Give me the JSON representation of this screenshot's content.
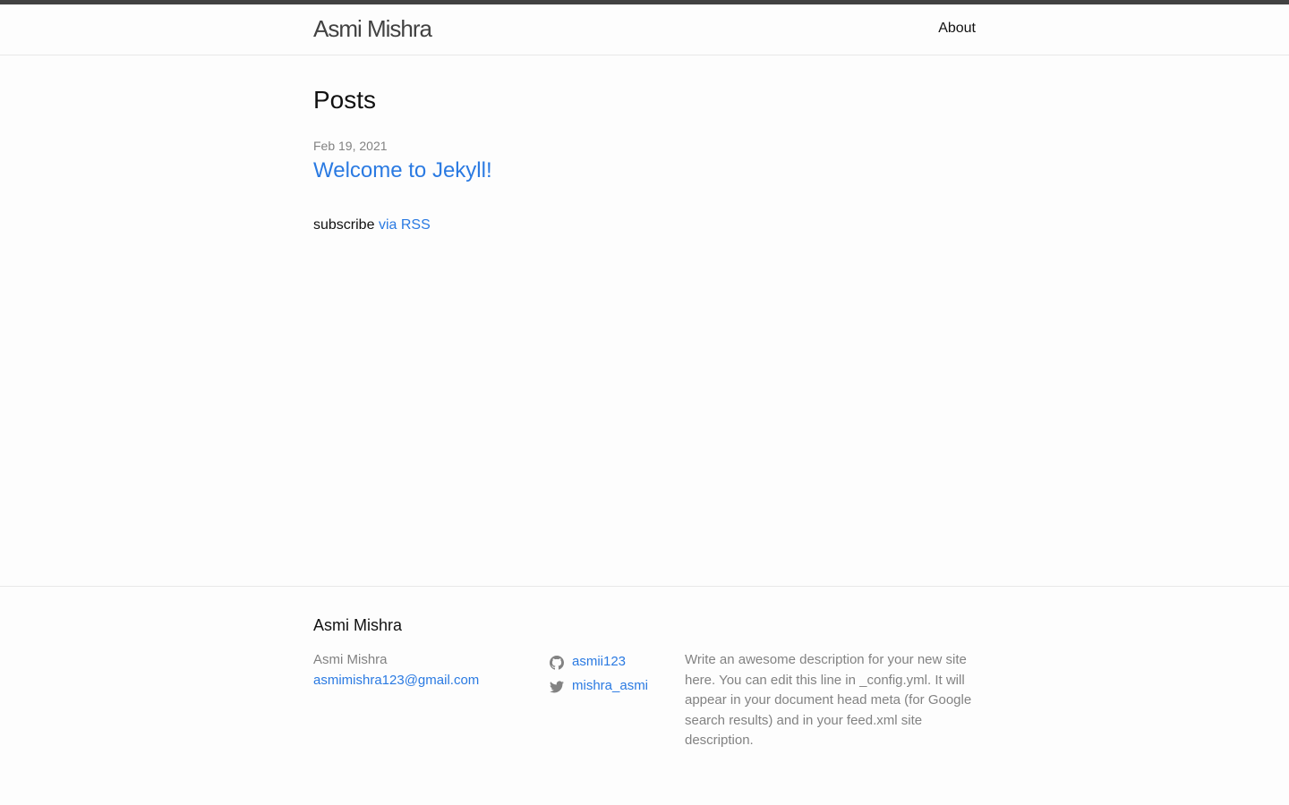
{
  "header": {
    "site_title": "Asmi Mishra",
    "nav_about": "About"
  },
  "main": {
    "heading": "Posts",
    "posts": [
      {
        "date": "Feb 19, 2021",
        "title": "Welcome to Jekyll!"
      }
    ],
    "rss_prefix": "subscribe",
    "rss_link": "via RSS"
  },
  "footer": {
    "heading": "Asmi Mishra",
    "name": "Asmi Mishra",
    "email": "asmimishra123@gmail.com",
    "social": [
      {
        "icon": "github-icon",
        "label": "asmii123"
      },
      {
        "icon": "twitter-icon",
        "label": "mishra_asmi"
      }
    ],
    "description": "Write an awesome description for your new site here. You can edit this line in _config.yml. It will appear in your document head meta (for Google search results) and in your feed.xml site description."
  },
  "colors": {
    "link": "#2a7ae2",
    "text": "#111111",
    "muted": "#828282",
    "header_border": "#424242",
    "background": "#fdfdfd"
  }
}
